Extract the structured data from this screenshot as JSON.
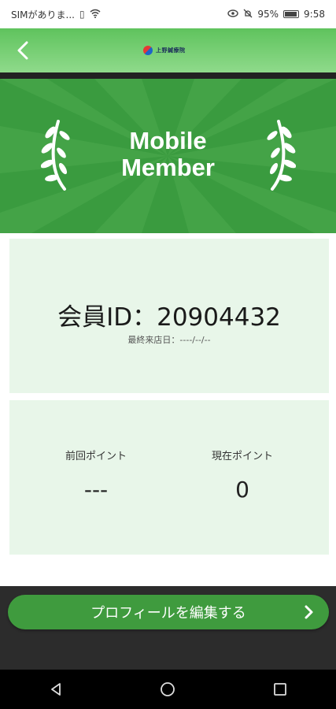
{
  "status_bar": {
    "carrier": "SIMがありま...",
    "battery": "95%",
    "time": "9:58"
  },
  "header": {
    "logo_text": "上野鍼療院"
  },
  "banner": {
    "title_line1": "Mobile",
    "title_line2": "Member"
  },
  "member": {
    "id_text": "会員ID：20904432",
    "last_visit": "最終来店日：----/--/--"
  },
  "points": {
    "previous_label": "前回ポイント",
    "previous_value": "---",
    "current_label": "現在ポイント",
    "current_value": "0"
  },
  "actions": {
    "edit_profile_label": "プロフィールを編集する"
  },
  "colors": {
    "primary_green": "#3f9b3e",
    "card_bg": "#e8f6e9"
  }
}
